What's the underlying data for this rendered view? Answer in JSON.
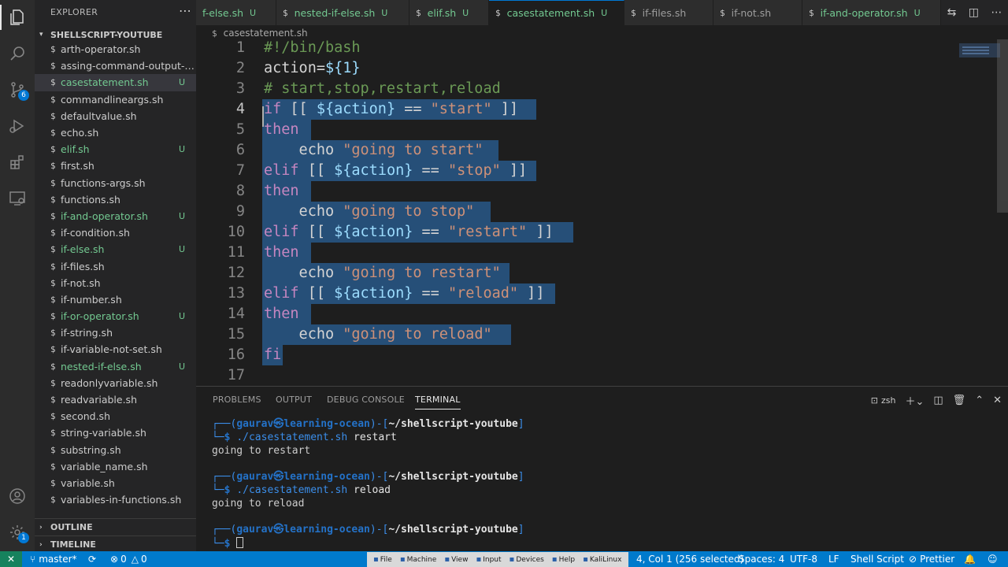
{
  "sidebar": {
    "title": "EXPLORER",
    "folder": "SHELLSCRIPT-YOUTUBE",
    "files": [
      {
        "name": "arth-operator.sh",
        "status": "",
        "untracked": false
      },
      {
        "name": "assing-command-output-to-...",
        "status": "",
        "untracked": false
      },
      {
        "name": "casestatement.sh",
        "status": "U",
        "untracked": true,
        "selected": true
      },
      {
        "name": "commandlineargs.sh",
        "status": "",
        "untracked": false
      },
      {
        "name": "defaultvalue.sh",
        "status": "",
        "untracked": false
      },
      {
        "name": "echo.sh",
        "status": "",
        "untracked": false
      },
      {
        "name": "elif.sh",
        "status": "U",
        "untracked": true
      },
      {
        "name": "first.sh",
        "status": "",
        "untracked": false
      },
      {
        "name": "functions-args.sh",
        "status": "",
        "untracked": false
      },
      {
        "name": "functions.sh",
        "status": "",
        "untracked": false
      },
      {
        "name": "if-and-operator.sh",
        "status": "U",
        "untracked": true
      },
      {
        "name": "if-condition.sh",
        "status": "",
        "untracked": false
      },
      {
        "name": "if-else.sh",
        "status": "U",
        "untracked": true
      },
      {
        "name": "if-files.sh",
        "status": "",
        "untracked": false
      },
      {
        "name": "if-not.sh",
        "status": "",
        "untracked": false
      },
      {
        "name": "if-number.sh",
        "status": "",
        "untracked": false
      },
      {
        "name": "if-or-operator.sh",
        "status": "U",
        "untracked": true
      },
      {
        "name": "if-string.sh",
        "status": "",
        "untracked": false
      },
      {
        "name": "if-variable-not-set.sh",
        "status": "",
        "untracked": false
      },
      {
        "name": "nested-if-else.sh",
        "status": "U",
        "untracked": true
      },
      {
        "name": "readonlyvariable.sh",
        "status": "",
        "untracked": false
      },
      {
        "name": "readvariable.sh",
        "status": "",
        "untracked": false
      },
      {
        "name": "second.sh",
        "status": "",
        "untracked": false
      },
      {
        "name": "string-variable.sh",
        "status": "",
        "untracked": false
      },
      {
        "name": "substring.sh",
        "status": "",
        "untracked": false
      },
      {
        "name": "variable_name.sh",
        "status": "",
        "untracked": false
      },
      {
        "name": "variable.sh",
        "status": "",
        "untracked": false
      },
      {
        "name": "variables-in-functions.sh",
        "status": "",
        "untracked": false
      }
    ],
    "outline": "OUTLINE",
    "timeline": "TIMELINE",
    "file_icon": "$"
  },
  "activity": {
    "scm_badge": "6",
    "accounts_badge": "1"
  },
  "tabs": [
    {
      "label": "f-else.sh",
      "status": "U"
    },
    {
      "label": "nested-if-else.sh",
      "status": "U"
    },
    {
      "label": "elif.sh",
      "status": "U"
    },
    {
      "label": "casestatement.sh",
      "status": "U",
      "active": true
    },
    {
      "label": "if-files.sh",
      "status": ""
    },
    {
      "label": "if-not.sh",
      "status": ""
    },
    {
      "label": "if-and-operator.sh",
      "status": "U"
    }
  ],
  "breadcrumb": {
    "file": "casestatement.sh"
  },
  "editor": {
    "lines": [
      {
        "n": "1",
        "tokens": [
          [
            "c-comment",
            "#!/bin/bash"
          ]
        ]
      },
      {
        "n": "2",
        "tokens": [
          [
            "c-plain",
            "action="
          ],
          [
            "c-var",
            "${1}"
          ]
        ]
      },
      {
        "n": "3",
        "tokens": [
          [
            "c-comment",
            "# start,stop,restart,reload"
          ]
        ]
      },
      {
        "n": "4",
        "tokens": [
          [
            "c-kw",
            "if"
          ],
          [
            "c-plain",
            " [[ "
          ],
          [
            "c-var",
            "${action}"
          ],
          [
            "c-plain",
            " == "
          ],
          [
            "c-str",
            "\"start\""
          ],
          [
            "c-plain",
            " ]]"
          ]
        ]
      },
      {
        "n": "5",
        "tokens": [
          [
            "c-kw",
            "then"
          ]
        ]
      },
      {
        "n": "6",
        "tokens": [
          [
            "c-plain",
            "    echo "
          ],
          [
            "c-str",
            "\"going to start\""
          ]
        ]
      },
      {
        "n": "7",
        "tokens": [
          [
            "c-kw",
            "elif"
          ],
          [
            "c-plain",
            " [[ "
          ],
          [
            "c-var",
            "${action}"
          ],
          [
            "c-plain",
            " == "
          ],
          [
            "c-str",
            "\"stop\""
          ],
          [
            "c-plain",
            " ]]"
          ]
        ]
      },
      {
        "n": "8",
        "tokens": [
          [
            "c-kw",
            "then"
          ]
        ]
      },
      {
        "n": "9",
        "tokens": [
          [
            "c-plain",
            "    echo "
          ],
          [
            "c-str",
            "\"going to stop\""
          ]
        ]
      },
      {
        "n": "10",
        "tokens": [
          [
            "c-kw",
            "elif"
          ],
          [
            "c-plain",
            " [[ "
          ],
          [
            "c-var",
            "${action}"
          ],
          [
            "c-plain",
            " == "
          ],
          [
            "c-str",
            "\"restart\""
          ],
          [
            "c-plain",
            " ]]"
          ]
        ]
      },
      {
        "n": "11",
        "tokens": [
          [
            "c-kw",
            "then"
          ]
        ]
      },
      {
        "n": "12",
        "tokens": [
          [
            "c-plain",
            "    echo "
          ],
          [
            "c-str",
            "\"going to restart\""
          ]
        ]
      },
      {
        "n": "13",
        "tokens": [
          [
            "c-kw",
            "elif"
          ],
          [
            "c-plain",
            " [[ "
          ],
          [
            "c-var",
            "${action}"
          ],
          [
            "c-plain",
            " == "
          ],
          [
            "c-str",
            "\"reload\""
          ],
          [
            "c-plain",
            " ]]"
          ]
        ]
      },
      {
        "n": "14",
        "tokens": [
          [
            "c-kw",
            "then"
          ]
        ]
      },
      {
        "n": "15",
        "tokens": [
          [
            "c-plain",
            "    echo "
          ],
          [
            "c-str",
            "\"going to reload\""
          ]
        ]
      },
      {
        "n": "16",
        "tokens": [
          [
            "c-kw",
            "fi"
          ]
        ]
      },
      {
        "n": "17",
        "tokens": []
      }
    ]
  },
  "panel": {
    "tabs": [
      "PROBLEMS",
      "OUTPUT",
      "DEBUG CONSOLE",
      "TERMINAL"
    ],
    "active_tab": "TERMINAL",
    "shell": "zsh",
    "terminal": [
      {
        "type": "prompt",
        "user": "gaurav",
        "host": "learning-ocean",
        "path": "~/shellscript-youtube",
        "cmd": "./casestatement.sh",
        "arg": "restart"
      },
      {
        "type": "output",
        "text": "going to restart"
      },
      {
        "type": "blank"
      },
      {
        "type": "prompt",
        "user": "gaurav",
        "host": "learning-ocean",
        "path": "~/shellscript-youtube",
        "cmd": "./casestatement.sh",
        "arg": "reload"
      },
      {
        "type": "output",
        "text": "going to reload"
      },
      {
        "type": "blank"
      },
      {
        "type": "prompt",
        "user": "gaurav",
        "host": "learning-ocean",
        "path": "~/shellscript-youtube",
        "cmd": "",
        "arg": "",
        "cursor": true
      }
    ]
  },
  "status": {
    "branch": "master*",
    "errors": "0",
    "warnings": "0",
    "position": "4, Col 1 (256 selected)",
    "spaces": "Spaces: 4",
    "encoding": "UTF-8",
    "eol": "LF",
    "language": "Shell Script",
    "prettier": "Prettier",
    "vbox_menu": [
      "File",
      "Machine",
      "View",
      "Input",
      "Devices",
      "Help",
      "KaliLinux"
    ]
  }
}
